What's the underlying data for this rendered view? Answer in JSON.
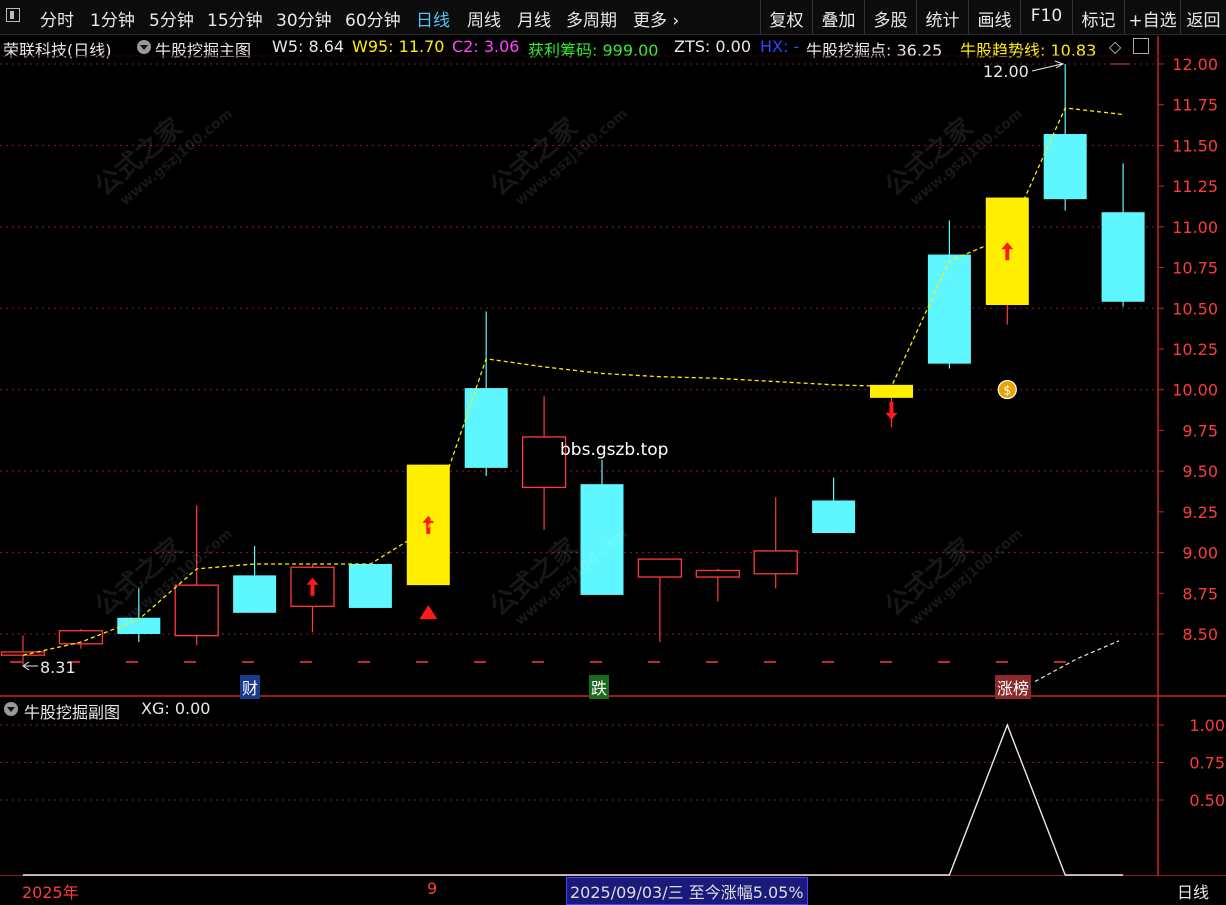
{
  "toolbar": {
    "tabs": [
      "分时",
      "1分钟",
      "5分钟",
      "15分钟",
      "30分钟",
      "60分钟",
      "日线",
      "周线",
      "月线",
      "多周期",
      "更多"
    ],
    "active_tab": "日线",
    "right_buttons": [
      "复权",
      "叠加",
      "多股",
      "统计",
      "画线",
      "F10",
      "标记",
      "+自选",
      "返回"
    ]
  },
  "header": {
    "stock": "荣联科技(日线)",
    "indicator": "牛股挖掘主图",
    "w5": "W5: 8.64",
    "w95": "W95: 11.70",
    "c2": "C2: 3.06",
    "profit_chips": "获利筹码: 999.00",
    "zts": "ZTS: 0.00",
    "hx": "HX: -",
    "dig_point": "牛股挖掘点: 36.25",
    "trend_line": "牛股趋势线: 10.83"
  },
  "sub_header": {
    "indicator": "牛股挖掘副图",
    "xg": "XG: 0.00"
  },
  "annotations": {
    "high_label": "12.00",
    "low_label": "8.31",
    "marks": [
      "财",
      "跌",
      "涨榜"
    ],
    "watermark_site": "bbs.gszb.top",
    "watermark_text": "公式之家",
    "watermark_url": "www.gszj100.com"
  },
  "bottom": {
    "year": "2025年",
    "month": "9",
    "date_info": "2025/09/03/三  至今涨幅5.05%",
    "period": "日线"
  },
  "colors": {
    "up": "#ff3b3b",
    "down": "#5ff7ff",
    "signal": "#ffee00",
    "trend": "#ffee00",
    "accent": "#4fc3ff"
  },
  "chart_data": [
    {
      "type": "candlestick",
      "title": "牛股挖掘主图",
      "ylim": [
        8.3,
        12.1
      ],
      "yticks": [
        8.5,
        8.75,
        9.0,
        9.25,
        9.5,
        9.75,
        10.0,
        10.25,
        10.5,
        10.75,
        11.0,
        11.25,
        11.5,
        11.75,
        12.0
      ],
      "candles": [
        {
          "o": 8.37,
          "h": 8.49,
          "l": 8.31,
          "c": 8.39,
          "kind": "up"
        },
        {
          "o": 8.44,
          "h": 8.53,
          "l": 8.41,
          "c": 8.52,
          "kind": "up"
        },
        {
          "o": 8.6,
          "h": 8.78,
          "l": 8.45,
          "c": 8.5,
          "kind": "down"
        },
        {
          "o": 8.49,
          "h": 9.29,
          "l": 8.43,
          "c": 8.8,
          "kind": "up"
        },
        {
          "o": 8.86,
          "h": 9.04,
          "l": 8.63,
          "c": 8.63,
          "kind": "down"
        },
        {
          "o": 8.67,
          "h": 8.93,
          "l": 8.51,
          "c": 8.91,
          "kind": "up",
          "arrow": "up"
        },
        {
          "o": 8.93,
          "h": 8.93,
          "l": 8.66,
          "c": 8.66,
          "kind": "down"
        },
        {
          "o": 8.8,
          "h": 9.54,
          "l": 8.8,
          "c": 9.54,
          "kind": "signal",
          "arrow": "up",
          "triangle": true
        },
        {
          "o": 10.01,
          "h": 10.48,
          "l": 9.47,
          "c": 9.52,
          "kind": "down"
        },
        {
          "o": 9.71,
          "h": 9.96,
          "l": 9.14,
          "c": 9.4,
          "kind": "up"
        },
        {
          "o": 9.42,
          "h": 9.57,
          "l": 8.74,
          "c": 8.74,
          "kind": "down"
        },
        {
          "o": 8.85,
          "h": 8.96,
          "l": 8.45,
          "c": 8.96,
          "kind": "up"
        },
        {
          "o": 8.85,
          "h": 8.9,
          "l": 8.7,
          "c": 8.89,
          "kind": "up"
        },
        {
          "o": 8.87,
          "h": 9.34,
          "l": 8.78,
          "c": 9.01,
          "kind": "up"
        },
        {
          "o": 9.32,
          "h": 9.46,
          "l": 9.12,
          "c": 9.12,
          "kind": "down"
        },
        {
          "o": 9.95,
          "h": 10.03,
          "l": 9.77,
          "c": 10.03,
          "kind": "signal",
          "arrow": "down"
        },
        {
          "o": 10.83,
          "h": 11.04,
          "l": 10.13,
          "c": 10.16,
          "kind": "down"
        },
        {
          "o": 10.52,
          "h": 11.18,
          "l": 10.4,
          "c": 11.18,
          "kind": "signal",
          "arrow": "up",
          "moneybag": true
        },
        {
          "o": 11.57,
          "h": 12.0,
          "l": 11.1,
          "c": 11.17,
          "kind": "down"
        },
        {
          "o": 11.09,
          "h": 11.39,
          "l": 10.51,
          "c": 10.54,
          "kind": "down"
        }
      ],
      "trend_line": [
        8.37,
        8.45,
        8.59,
        8.9,
        8.93,
        8.93,
        8.93,
        9.15,
        10.19,
        10.14,
        10.1,
        10.08,
        10.07,
        10.05,
        10.03,
        10.02,
        10.79,
        10.94,
        11.73,
        11.69
      ],
      "support_line": 8.37,
      "extra_dashed": [
        8.38,
        8.52,
        8.63
      ]
    },
    {
      "type": "line",
      "title": "牛股挖掘副图",
      "ylim": [
        0,
        1.1
      ],
      "yticks": [
        0.5,
        0.75,
        1.0
      ],
      "values": [
        0,
        0,
        0,
        0,
        0,
        0,
        0,
        0,
        0,
        0,
        0,
        0,
        0,
        0,
        0,
        0,
        0,
        1,
        0,
        0
      ]
    }
  ]
}
